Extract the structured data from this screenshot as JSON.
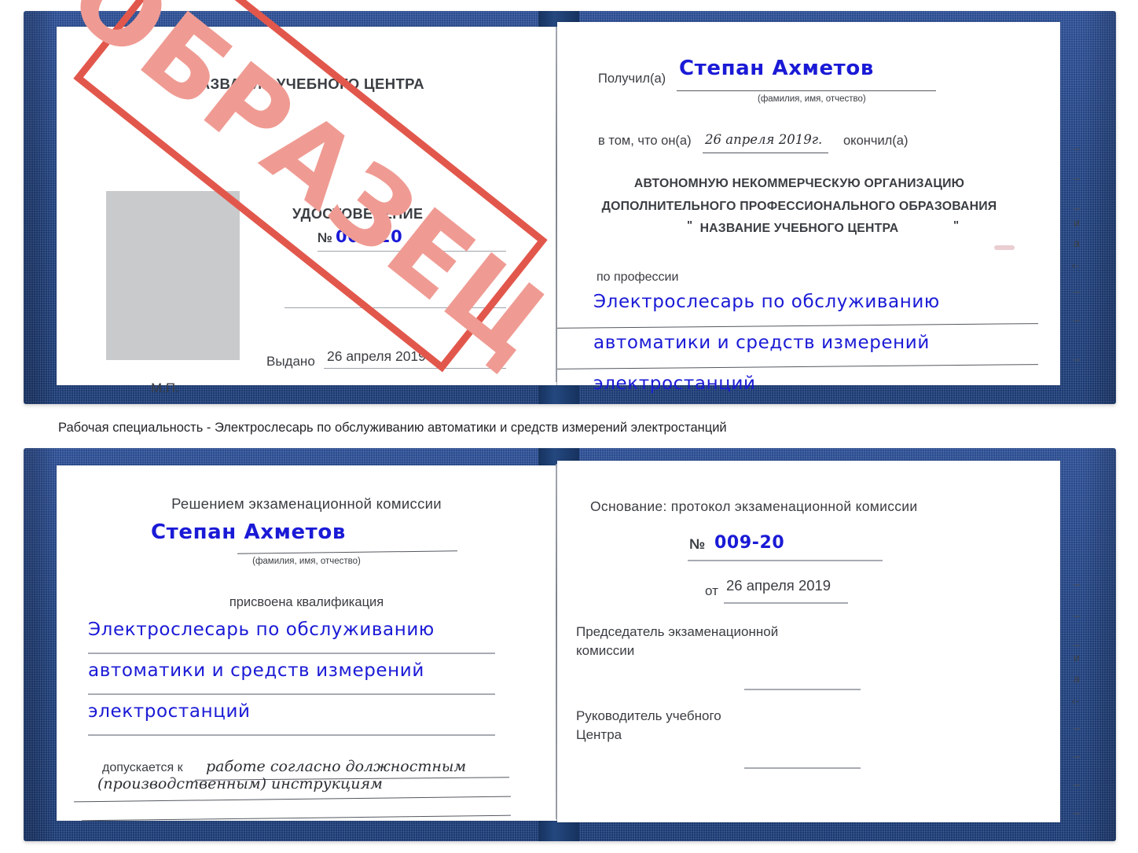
{
  "document": {
    "kind": "Russian training-centre certificate (udostoverenie) sample scan",
    "sample_stamp": "ОБРАЗЕЦ"
  },
  "caption": {
    "text": "Рабочая специальность - Электрослесарь по обслуживанию автоматики и средств измерений электростанций"
  },
  "cert_top": {
    "left_page": {
      "org_title": "НАЗВАНИЕ УЧЕБНОГО ЦЕНТРА",
      "doc_type": "УДОСТОВЕРЕНИЕ",
      "number_label": "№",
      "number_value": "009-20",
      "issued_label": "Выдано",
      "issued_value": "26 апреля 2019",
      "seal_label": "М.П.",
      "photo_placeholder": "photo-placeholder"
    },
    "right_page": {
      "received_label": "Получил(а)",
      "received_value": "Степан Ахметов",
      "fio_hint": "(фамилия, имя, отчество)",
      "in_that_label": "в том, что он(а)",
      "completion_date": "26 апреля 2019г.",
      "finished_label": "окончил(а)",
      "org_line_1": "АВТОНОМНУЮ НЕКОММЕРЧЕСКУЮ ОРГАНИЗАЦИЮ",
      "org_line_2": "ДОПОЛНИТЕЛЬНОГО ПРОФЕССИОНАЛЬНОГО ОБРАЗОВАНИЯ",
      "org_quote_open": "\"",
      "org_line_3": "НАЗВАНИЕ УЧЕБНОГО ЦЕНТРА",
      "org_quote_close": "\"",
      "profession_label": "по профессии",
      "profession_line_1": "Электрослесарь по обслуживанию",
      "profession_line_2": "автоматики и средств измерений",
      "profession_line_3": "электростанций",
      "edge_fragments": [
        "–",
        "–",
        "–",
        "и",
        "а",
        "‹-",
        "–",
        "–",
        "–"
      ]
    }
  },
  "cert_bottom": {
    "left_page": {
      "decision_label": "Решением экзаменационной комиссии",
      "name_value": "Степан Ахметов",
      "fio_hint": "(фамилия, имя, отчество)",
      "qualification_label": "присвоена квалификация",
      "qualification_line_1": "Электрослесарь по обслуживанию",
      "qualification_line_2": "автоматики и средств измерений",
      "qualification_line_3": "электростанций",
      "admitted_label": "допускается к",
      "admitted_value_1": "работе согласно должностным",
      "admitted_value_2": "(производственным) инструкциям"
    },
    "right_page": {
      "basis_label": "Основание: протокол экзаменационной комиссии",
      "number_label": "№",
      "number_value": "009-20",
      "date_label": "от",
      "date_value": "26 апреля 2019",
      "chairman_line_1": "Председатель экзаменационной",
      "chairman_line_2": "комиссии",
      "head_line_1": "Руководитель учебного",
      "head_line_2": "Центра",
      "edge_fragments": [
        "–",
        "–",
        "–",
        "и",
        "а",
        "‹-",
        "–",
        "–",
        "–",
        "–"
      ]
    }
  },
  "colors": {
    "cover_blue": "#20417f",
    "handwriting_blue": "#1a1ad6",
    "stamp_red": "#e2574c",
    "stamp_fill": "#ef9b93",
    "photo_gray": "#c9cacb",
    "rule_gray": "#6d7179"
  }
}
